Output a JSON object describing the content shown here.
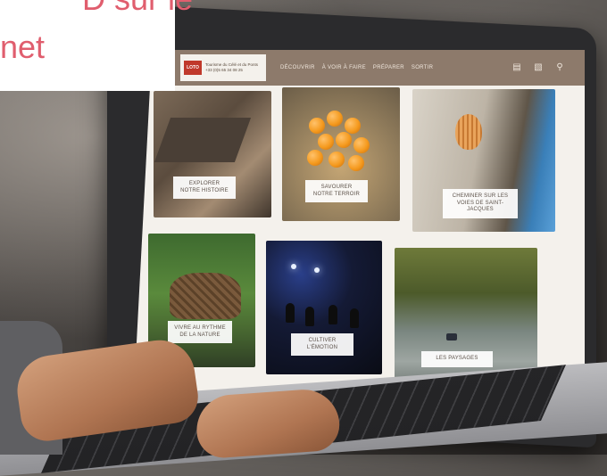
{
  "heading": {
    "line1": "D sur le",
    "line2": "net"
  },
  "site": {
    "logo_mark": "LOTO",
    "logo_line1": "Tourisme du Célé et du Ponts",
    "logo_line2": "+33 (0)5 65 34 08 25"
  },
  "nav": {
    "items": [
      "DÉCOUVRIR",
      "À VOIR À FAIRE",
      "PRÉPARER",
      "SORTIR"
    ]
  },
  "tools": {
    "icons": [
      "map-icon",
      "brochure-icon",
      "search-icon"
    ]
  },
  "tiles": [
    {
      "label": "EXPLORER NOTRE HISTOIRE"
    },
    {
      "label": "SAVOURER NOTRE TERROIR"
    },
    {
      "label": "CHEMINER SUR LES VOIES DE SAINT-JACQUES"
    },
    {
      "label": "VIVRE AU RYTHME DE LA NATURE"
    },
    {
      "label": "CULTIVER L'ÉMOTION"
    },
    {
      "label": "LES PAYSAGES"
    }
  ],
  "colors": {
    "accent": "#e05e6e",
    "topbar": "#8d7a6b"
  }
}
